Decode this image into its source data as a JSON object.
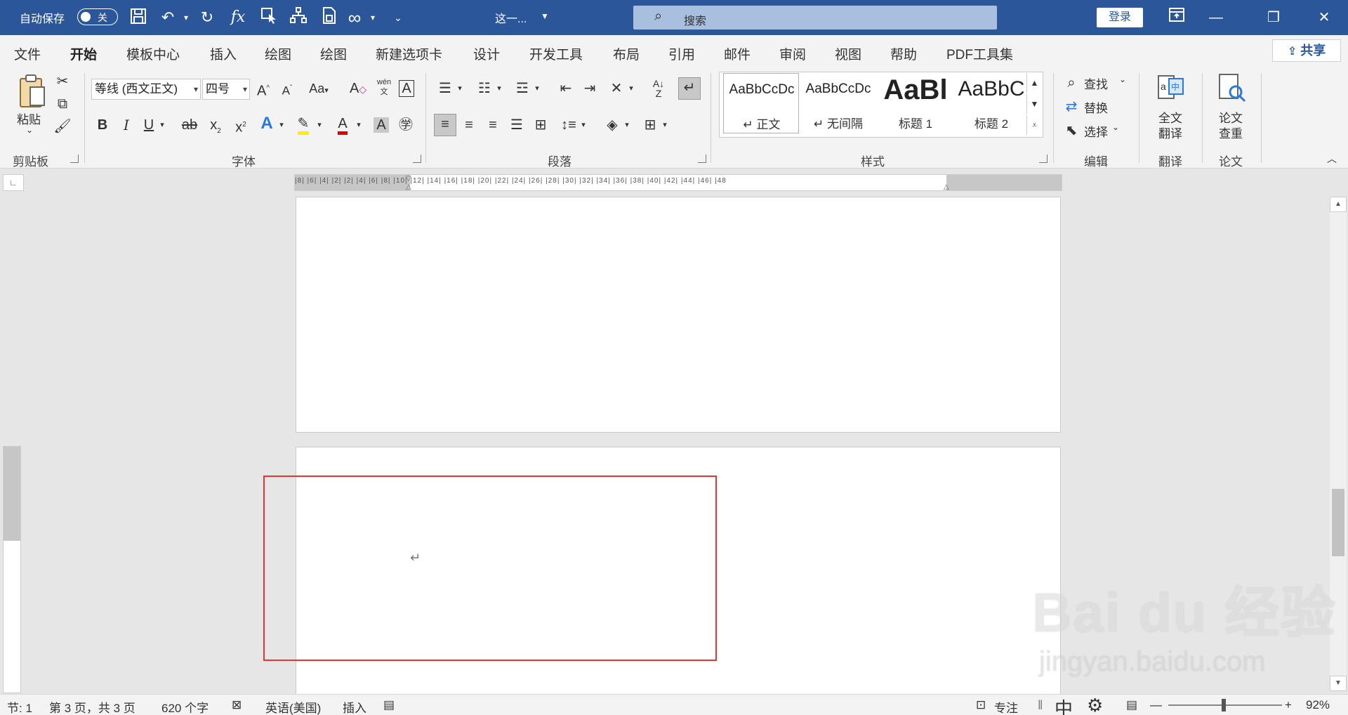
{
  "titlebar": {
    "autosave_label": "自动保存",
    "autosave_toggle": "关",
    "doc_title": "这一...",
    "search_placeholder": "搜索",
    "login_label": "登录",
    "background_color": "#2b579a"
  },
  "tabs": [
    {
      "label": "文件"
    },
    {
      "label": "开始",
      "active": true
    },
    {
      "label": "模板中心"
    },
    {
      "label": "插入"
    },
    {
      "label": "绘图"
    },
    {
      "label": "绘图"
    },
    {
      "label": "新建选项卡"
    },
    {
      "label": "设计"
    },
    {
      "label": "开发工具"
    },
    {
      "label": "布局"
    },
    {
      "label": "引用"
    },
    {
      "label": "邮件"
    },
    {
      "label": "审阅"
    },
    {
      "label": "视图"
    },
    {
      "label": "帮助"
    },
    {
      "label": "PDF工具集"
    }
  ],
  "share_label": "共享",
  "ribbon": {
    "clipboard": {
      "paste_label": "粘贴",
      "group_label": "剪贴板"
    },
    "font": {
      "font_name": "等线 (西文正文)",
      "font_size": "四号",
      "case_label": "Aa",
      "group_label": "字体"
    },
    "paragraph": {
      "group_label": "段落"
    },
    "styles": {
      "items": [
        {
          "sample": "AaBbCcDc",
          "name": "正文"
        },
        {
          "sample": "AaBbCcDc",
          "name": "无间隔"
        },
        {
          "sample": "AaBl",
          "name": "标题 1"
        },
        {
          "sample": "AaBbC",
          "name": "标题 2"
        }
      ],
      "group_label": "样式"
    },
    "editing": {
      "find_label": "查找",
      "replace_label": "替换",
      "select_label": "选择",
      "group_label": "编辑"
    },
    "translate": {
      "full_label_1": "全文",
      "full_label_2": "翻译",
      "group_label": "翻译"
    },
    "paper": {
      "check_label_1": "论文",
      "check_label_2": "查重",
      "group_label": "论文"
    }
  },
  "ruler": {
    "numbers": "|8|  |6|  |4|  |2|     |2|  |4|  |6|  |8|  |10|  |12|  |14|  |16|  |18|  |20|  |22|  |24|  |26|  |28|  |30|  |32|  |34|  |36|  |38|  |40|  |42|  |44|  |46|  |48"
  },
  "status": {
    "section": "节: 1",
    "page": "第 3 页，共 3 页",
    "words": "620 个字",
    "language": "英语(美国)",
    "insert_mode": "插入",
    "focus_label": "专注",
    "ime": "中",
    "zoom": "92%"
  },
  "watermark": {
    "main": "Bai du 经验",
    "sub": "jingyan.baidu.com"
  },
  "annotation_color": "#e63333"
}
